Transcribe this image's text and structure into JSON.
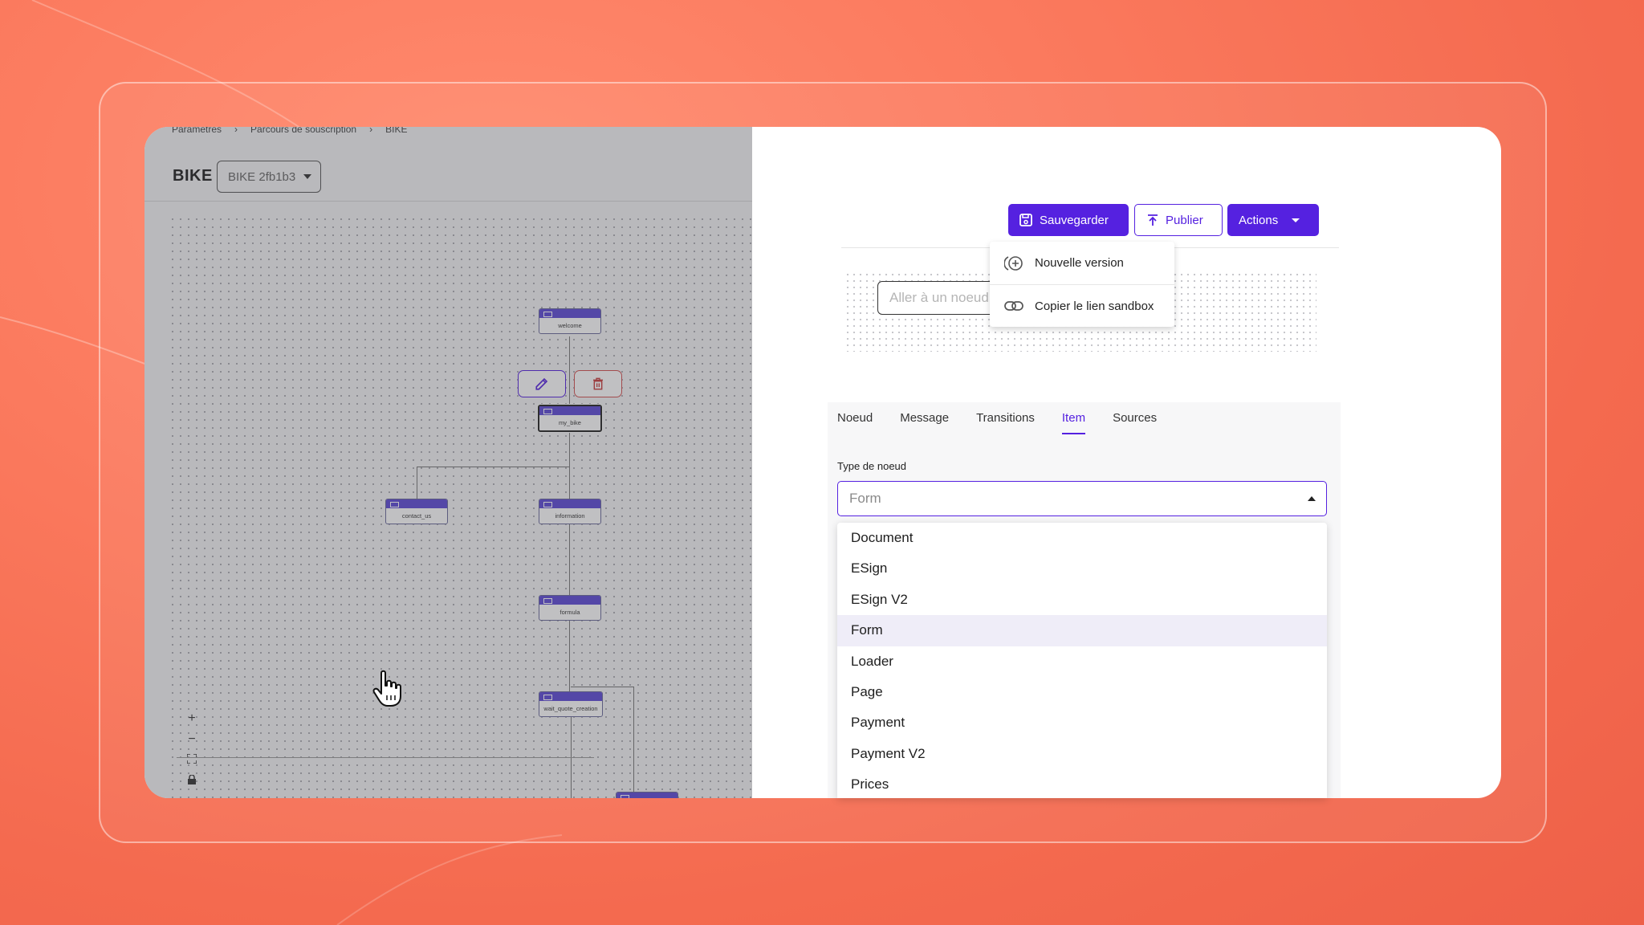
{
  "left": {
    "breadcrumb": [
      "Paramètres",
      "Parcours de souscription",
      "BIKE"
    ],
    "title": "BIKE",
    "version": "BIKE 2fb1b3",
    "nodes": {
      "welcome": "welcome",
      "my_bike": "my_bike",
      "contact_us": "contact_us",
      "information": "information",
      "formula": "formula",
      "wait_quote_creation": "wait_quote_creation"
    },
    "zoom": {
      "in": "+",
      "out": "−"
    }
  },
  "toolbar": {
    "save": "Sauvegarder",
    "publish": "Publier",
    "actions": "Actions"
  },
  "actions_menu": {
    "new_version": "Nouvelle version",
    "copy_sandbox": "Copier le lien sandbox"
  },
  "goto": {
    "placeholder": "Aller à un noeud"
  },
  "tabs": [
    "Noeud",
    "Message",
    "Transitions",
    "Item",
    "Sources"
  ],
  "active_tab": "Item",
  "type_field": {
    "label": "Type de noeud",
    "value": "Form",
    "options": [
      "Document",
      "ESign",
      "ESign V2",
      "Form",
      "Loader",
      "Page",
      "Payment",
      "Payment V2",
      "Prices"
    ]
  },
  "colors": {
    "accent": "#5521e0",
    "background": "#f46a4f"
  }
}
